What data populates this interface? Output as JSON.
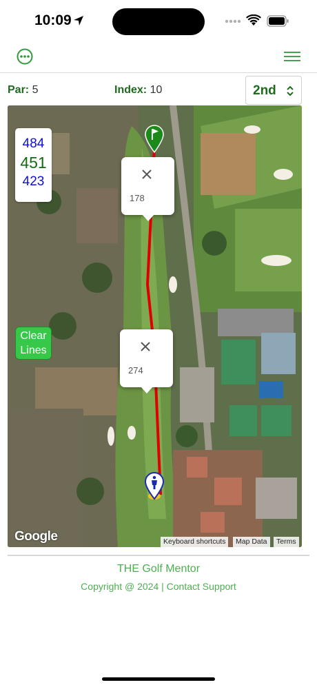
{
  "status_bar": {
    "time": "10:09"
  },
  "header": {
    "more_icon": "ellipsis-circle-icon",
    "menu_icon": "hamburger-menu-icon"
  },
  "hole": {
    "par_label": "Par:",
    "par_value": "5",
    "index_label": "Index:",
    "index_value": "10",
    "tee_selected": "2nd"
  },
  "yardage": {
    "back": "484",
    "center": "451",
    "front": "423"
  },
  "map": {
    "clear_lines_label": "Clear Lines",
    "segment_upper_distance": "178",
    "segment_lower_distance": "274",
    "google_label": "Google",
    "attribution": {
      "keyboard_shortcuts": "Keyboard shortcuts",
      "map_data": "Map Data",
      "terms": "Terms"
    },
    "colors": {
      "flag_marker": "#1b8a1b",
      "player_marker": "#1a2bb0",
      "shot_line": "#e00000",
      "clear_lines_button": "#37c84a"
    }
  },
  "footer": {
    "title": "THE Golf Mentor",
    "copyright": "Copyright @ 2024 | Contact Support"
  }
}
